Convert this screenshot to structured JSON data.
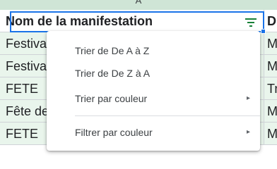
{
  "sheet": {
    "column_letter": "A",
    "header": {
      "col_a": "Nom de la manifestation",
      "col_b": "D"
    },
    "rows": [
      {
        "col_a": "Festival",
        "col_b": "M"
      },
      {
        "col_a": "Festival",
        "col_b": "M"
      },
      {
        "col_a": "FETE",
        "col_b": "Tr"
      },
      {
        "col_a": "Fête de",
        "col_b": "M"
      },
      {
        "col_a": "FETE",
        "col_b": "M"
      }
    ]
  },
  "filter_icon": "filter-icon",
  "menu": {
    "sort_az": "Trier de De A à Z",
    "sort_za": "Trier de De Z à A",
    "sort_by_color": "Trier par couleur",
    "filter_by_color": "Filtrer par couleur",
    "submenu_arrow": "▸"
  },
  "colors": {
    "accent": "#1a73e8",
    "filter_green": "#188038",
    "row_tint": "#e9f5ec"
  }
}
